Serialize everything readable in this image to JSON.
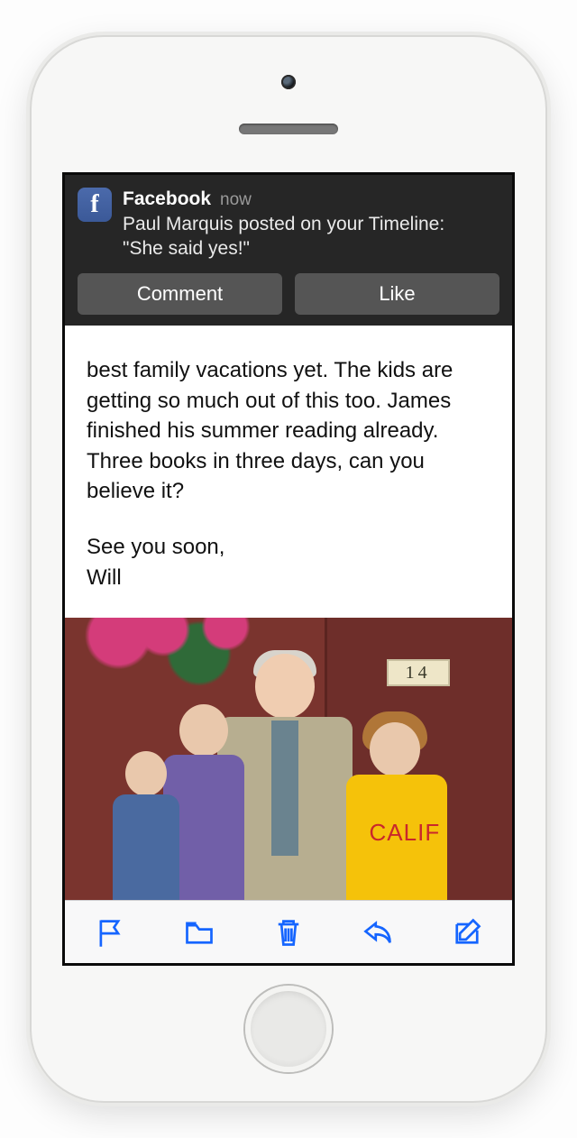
{
  "notification": {
    "app_name": "Facebook",
    "timestamp": "now",
    "body_line1": "Paul Marquis posted on your Timeline:",
    "body_line2": "\"She said yes!\"",
    "actions": {
      "comment": "Comment",
      "like": "Like"
    }
  },
  "email": {
    "paragraph": "best family vacations yet. The kids are getting so much out of this too. James finished his summer reading already. Three books in three days, can you believe it?",
    "signoff": "See you soon,",
    "sender": "Will",
    "photo_house_number": "14",
    "photo_shirt_text": "CALIF"
  },
  "toolbar_labels": {
    "flag": "Flag",
    "move": "Move",
    "trash": "Trash",
    "reply": "Reply",
    "compose": "Compose"
  }
}
